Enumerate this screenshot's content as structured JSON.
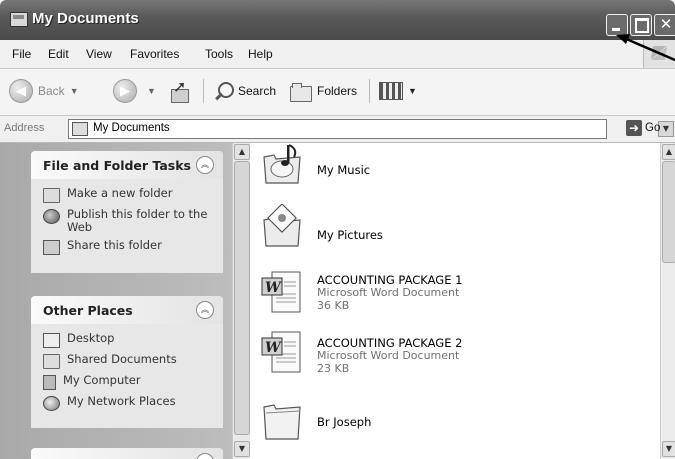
{
  "window": {
    "title": "My Documents"
  },
  "menu": {
    "items": [
      "File",
      "Edit",
      "View",
      "Favorites",
      "Tools",
      "Help"
    ]
  },
  "toolbar": {
    "back_label": "Back",
    "search_label": "Search",
    "folders_label": "Folders"
  },
  "address": {
    "label": "Address",
    "value": "My Documents",
    "go_label": "Go"
  },
  "tasks": {
    "file_folder": {
      "title": "File and Folder Tasks",
      "items": [
        "Make a new folder",
        "Publish this folder to the Web",
        "Share this folder"
      ]
    },
    "other_places": {
      "title": "Other Places",
      "items": [
        "Desktop",
        "Shared Documents",
        "My Computer",
        "My Network Places"
      ]
    }
  },
  "files": [
    {
      "name": "My Music",
      "type": "",
      "size": "",
      "icon": "music-folder-icon"
    },
    {
      "name": "My Pictures",
      "type": "",
      "size": "",
      "icon": "pictures-folder-icon"
    },
    {
      "name": "ACCOUNTING PACKAGE 1",
      "type": "Microsoft Word Document",
      "size": "36 KB",
      "icon": "word-document-icon"
    },
    {
      "name": "ACCOUNTING PACKAGE 2",
      "type": "Microsoft Word Document",
      "size": "23 KB",
      "icon": "word-document-icon"
    },
    {
      "name": "Br Joseph",
      "type": "",
      "size": "",
      "icon": "folder-icon"
    }
  ]
}
